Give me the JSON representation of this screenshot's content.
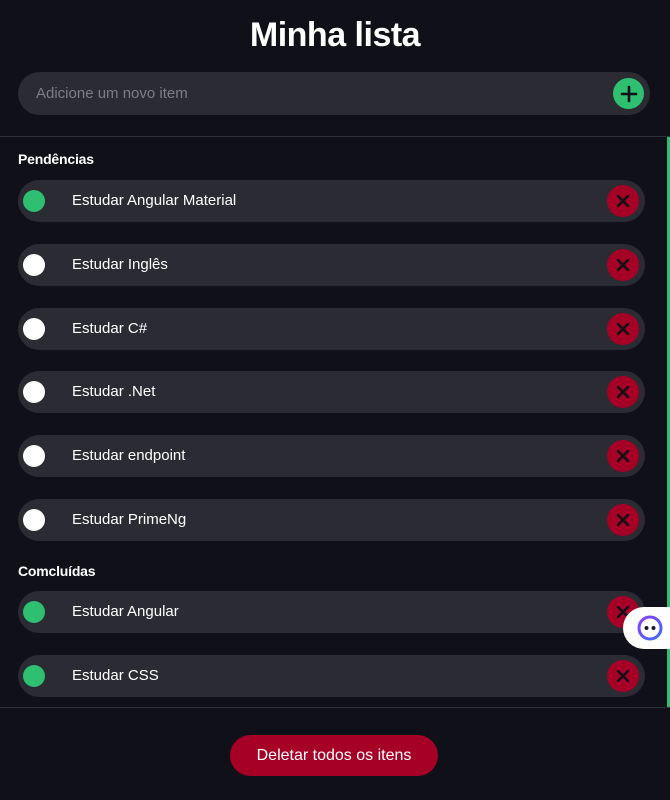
{
  "header": {
    "title": "Minha lista"
  },
  "add": {
    "placeholder": "Adicione um novo item",
    "button_icon": "plus-icon"
  },
  "sections": [
    {
      "title": "Pendências",
      "items": [
        {
          "label": "Estudar Angular Material",
          "checked": true
        },
        {
          "label": "Estudar Inglês",
          "checked": false
        },
        {
          "label": "Estudar C#",
          "checked": false
        },
        {
          "label": "Estudar .Net",
          "checked": false
        },
        {
          "label": "Estudar endpoint",
          "checked": false
        },
        {
          "label": "Estudar PrimeNg",
          "checked": false
        }
      ]
    },
    {
      "title": "Comcluídas",
      "items": [
        {
          "label": "Estudar Angular",
          "checked": true
        },
        {
          "label": "Estudar CSS",
          "checked": true
        }
      ]
    }
  ],
  "footer": {
    "delete_all_label": "Deletar todos os itens"
  },
  "colors": {
    "background": "#0f1018",
    "surface": "#2b2b33",
    "accent_green": "#2ec070",
    "danger_red": "#a60027"
  },
  "icons": {
    "delete": "close-icon",
    "widget": "assistant-face-icon"
  }
}
